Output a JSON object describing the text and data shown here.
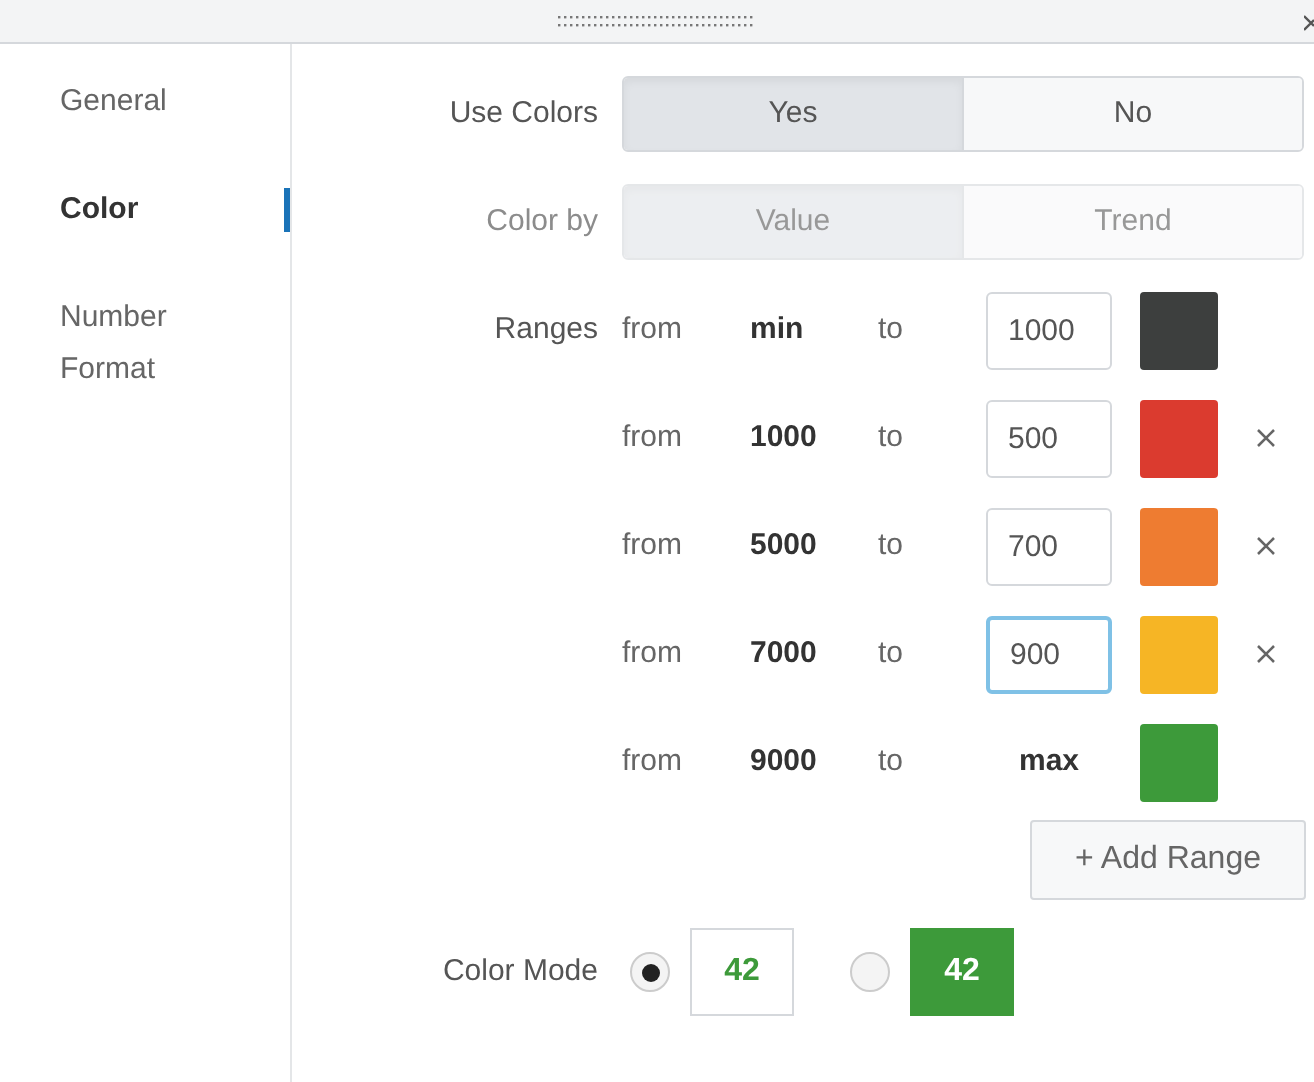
{
  "sidebar": {
    "items": [
      {
        "label": "General",
        "selected": false
      },
      {
        "label": "Color",
        "selected": true
      },
      {
        "label": "Number Format",
        "selected": false
      }
    ]
  },
  "use_colors": {
    "label": "Use Colors",
    "disabled": false,
    "options": [
      {
        "label": "Yes",
        "selected": true
      },
      {
        "label": "No",
        "selected": false
      }
    ]
  },
  "color_by": {
    "label": "Color by",
    "disabled": true,
    "options": [
      {
        "label": "Value",
        "selected": true
      },
      {
        "label": "Trend",
        "selected": false
      }
    ]
  },
  "ranges": {
    "label": "Ranges",
    "rows": [
      {
        "from_label": "from",
        "from": "min",
        "to_label": "to",
        "to": "1000",
        "kind": "field",
        "focused": false,
        "color": "#3d3f3e",
        "removable": false
      },
      {
        "from_label": "from",
        "from": "1000",
        "to_label": "to",
        "to": "500",
        "kind": "field",
        "focused": false,
        "color": "#db3b2f",
        "removable": true
      },
      {
        "from_label": "from",
        "from": "5000",
        "to_label": "to",
        "to": "700",
        "kind": "field",
        "focused": false,
        "color": "#ee7c31",
        "removable": true
      },
      {
        "from_label": "from",
        "from": "7000",
        "to_label": "to",
        "to": "900",
        "kind": "field",
        "focused": true,
        "color": "#f6b525",
        "removable": true
      },
      {
        "from_label": "from",
        "from": "9000",
        "to_label": "to",
        "to": "max",
        "kind": "text",
        "color": "#3d9a3a",
        "removable": false
      }
    ],
    "add_button": "+ Add Range"
  },
  "color_mode": {
    "label": "Color Mode",
    "options": [
      {
        "kind": "text",
        "sample": "42",
        "selected": true
      },
      {
        "kind": "fill",
        "sample": "42",
        "selected": false
      }
    ]
  }
}
